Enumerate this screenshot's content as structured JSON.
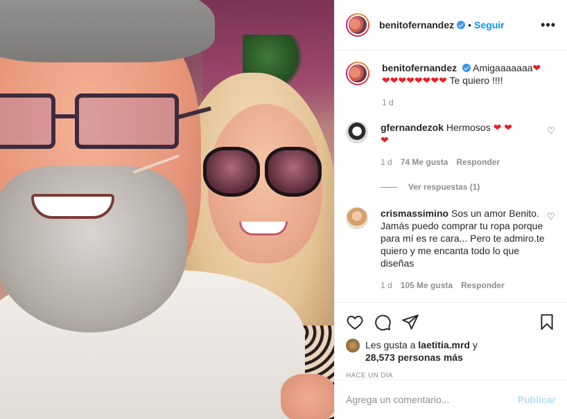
{
  "post": {
    "author": "benitofernandez",
    "follow_label": "Seguir",
    "dot": "•",
    "more_label": "•••"
  },
  "caption": {
    "user": "benitofernandez",
    "text_1": "Amigaaaaaaa",
    "hearts_1": "❤",
    "hearts_2": "❤❤❤❤❤❤❤❤",
    "text_2": " Te quiero !!!!",
    "time": "1 d"
  },
  "comments": [
    {
      "user": "gfernandezok",
      "text": "Hermosos ",
      "hearts_a": "❤ ❤",
      "hearts_b": "❤",
      "time": "1 d",
      "likes": "74 Me gusta",
      "reply": "Responder",
      "view_replies": "Ver respuestas (1)"
    },
    {
      "user": "crismassimino",
      "text": "Sos un amor Benito. Jamás puedo comprar tu ropa porque para mí es re cara... Pero te admiro.te quiero y me encanta todo lo que diseñas",
      "time": "1 d",
      "likes": "105 Me gusta",
      "reply": "Responder"
    }
  ],
  "likes": {
    "prefix": "Les gusta a ",
    "user": "laetitia.mrd",
    "suffix": " y",
    "count": "28,573 personas más"
  },
  "posted_ago": "HACE UN DÍA",
  "add_comment": {
    "placeholder": "Agrega un comentario...",
    "publish_label": "Publicar"
  },
  "icons": {
    "like": "heart-outline-icon",
    "comment": "comment-icon",
    "share": "paper-plane-icon",
    "save": "bookmark-icon",
    "verified": "verified-badge-icon"
  },
  "colors": {
    "link": "#0095f6",
    "verified": "#3897f0",
    "heart": "#ed1c24",
    "muted": "#8e8e8e",
    "publish_disabled": "#b2dffc"
  }
}
